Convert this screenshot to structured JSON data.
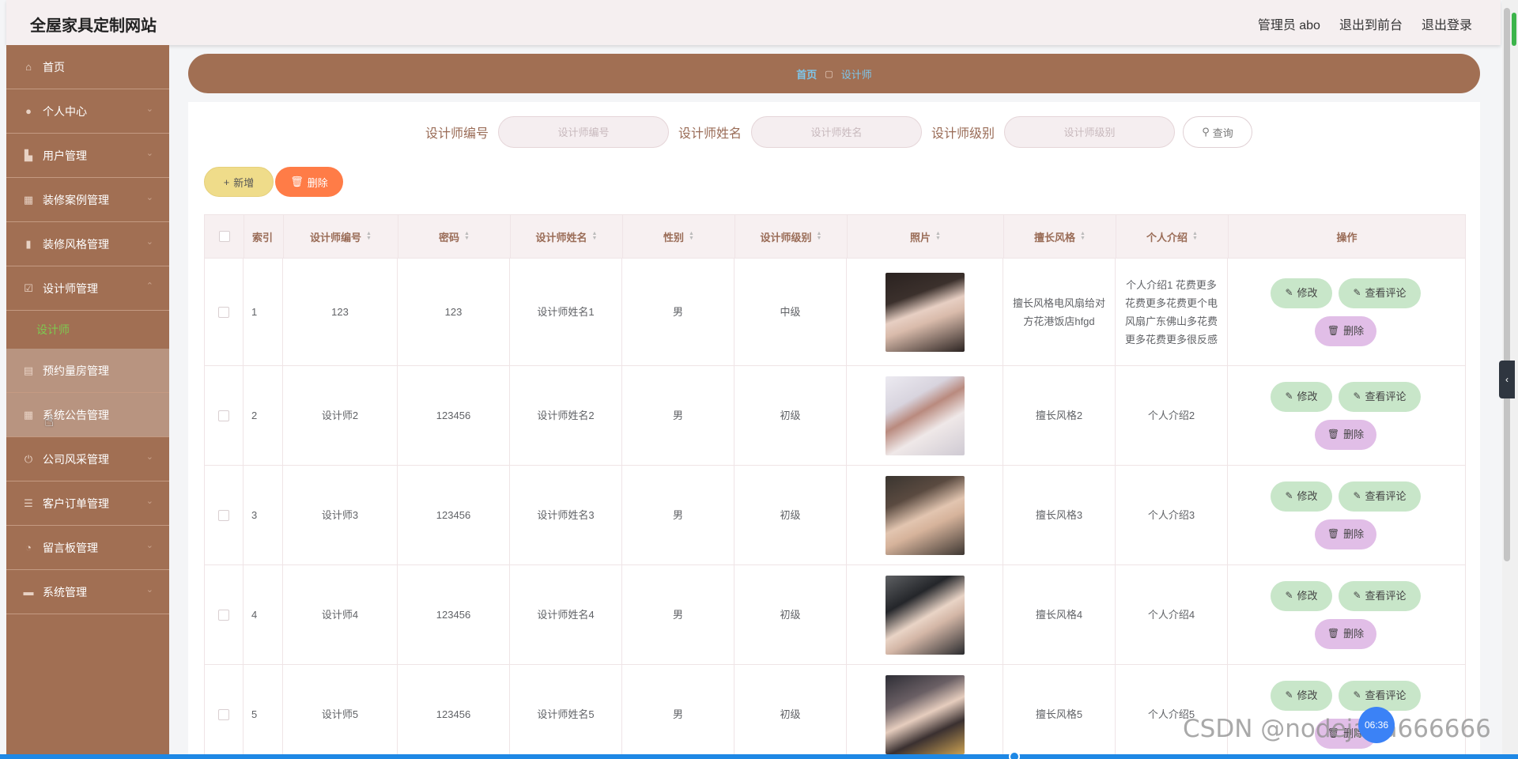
{
  "app": {
    "title": "全屋家具定制网站",
    "user_label": "管理员 abo",
    "to_front_label": "退出到前台",
    "logout_label": "退出登录"
  },
  "sidebar": {
    "items": [
      {
        "label": "首页",
        "icon": "home-icon",
        "has_chevron": false
      },
      {
        "label": "个人中心",
        "icon": "user-icon",
        "has_chevron": true
      },
      {
        "label": "用户管理",
        "icon": "users-icon",
        "has_chevron": true
      },
      {
        "label": "装修案例管理",
        "icon": "grid-icon",
        "has_chevron": true
      },
      {
        "label": "装修风格管理",
        "icon": "bar-chart-icon",
        "has_chevron": true
      },
      {
        "label": "设计师管理",
        "icon": "check-square-icon",
        "has_chevron": true
      }
    ],
    "active_sub": "设计师",
    "items_after": [
      {
        "label": "预约量房管理",
        "icon": "calendar-icon",
        "has_chevron": false,
        "highlight": true
      },
      {
        "label": "系统公告管理",
        "icon": "grid-icon",
        "has_chevron": false,
        "highlight": true
      },
      {
        "label": "公司风采管理",
        "icon": "power-icon",
        "has_chevron": true
      },
      {
        "label": "客户订单管理",
        "icon": "list-icon",
        "has_chevron": true
      },
      {
        "label": "留言板管理",
        "icon": "message-icon",
        "has_chevron": true
      },
      {
        "label": "系统管理",
        "icon": "database-icon",
        "has_chevron": true
      }
    ]
  },
  "breadcrumb": {
    "home": "首页",
    "current": "设计师"
  },
  "search": {
    "fields": [
      {
        "label": "设计师编号",
        "placeholder": "设计师编号"
      },
      {
        "label": "设计师姓名",
        "placeholder": "设计师姓名"
      },
      {
        "label": "设计师级别",
        "placeholder": "设计师级别"
      }
    ],
    "button_label": "查询"
  },
  "toolbar": {
    "add_label": "新增",
    "delete_label": "删除"
  },
  "table": {
    "columns": [
      "索引",
      "设计师编号",
      "密码",
      "设计师姓名",
      "性别",
      "设计师级别",
      "照片",
      "擅长风格",
      "个人介绍",
      "操作"
    ],
    "rows": [
      {
        "index": "1",
        "code": "123",
        "password": "123",
        "name": "设计师姓名1",
        "gender": "男",
        "level": "中级",
        "photo": "ph1",
        "style": "擅长风格电风扇给对方花港饭店hfgd",
        "intro": "个人介绍1 花费更多花费更多花费更个电风扇广东佛山多花费更多花费更多很反感"
      },
      {
        "index": "2",
        "code": "设计师2",
        "password": "123456",
        "name": "设计师姓名2",
        "gender": "男",
        "level": "初级",
        "photo": "ph2",
        "style": "擅长风格2",
        "intro": "个人介绍2"
      },
      {
        "index": "3",
        "code": "设计师3",
        "password": "123456",
        "name": "设计师姓名3",
        "gender": "男",
        "level": "初级",
        "photo": "ph3",
        "style": "擅长风格3",
        "intro": "个人介绍3"
      },
      {
        "index": "4",
        "code": "设计师4",
        "password": "123456",
        "name": "设计师姓名4",
        "gender": "男",
        "level": "初级",
        "photo": "ph4",
        "style": "擅长风格4",
        "intro": "个人介绍4"
      },
      {
        "index": "5",
        "code": "设计师5",
        "password": "123456",
        "name": "设计师姓名5",
        "gender": "男",
        "level": "初级",
        "photo": "ph5",
        "style": "擅长风格5",
        "intro": "个人介绍5"
      }
    ],
    "ops": {
      "edit_label": "修改",
      "comment_label": "查看评论",
      "delete_label": "删除"
    }
  },
  "overlay": {
    "watermark": "CSDN @nodejava666666",
    "timer": "06:36"
  },
  "colors": {
    "sidebar_bg": "#a16f53",
    "accent_green": "#7ec850",
    "add_btn": "#efdc8a",
    "delete_btn": "#ff7c47",
    "op_green": "#c8e6c9",
    "op_purple": "#e1bee7"
  }
}
